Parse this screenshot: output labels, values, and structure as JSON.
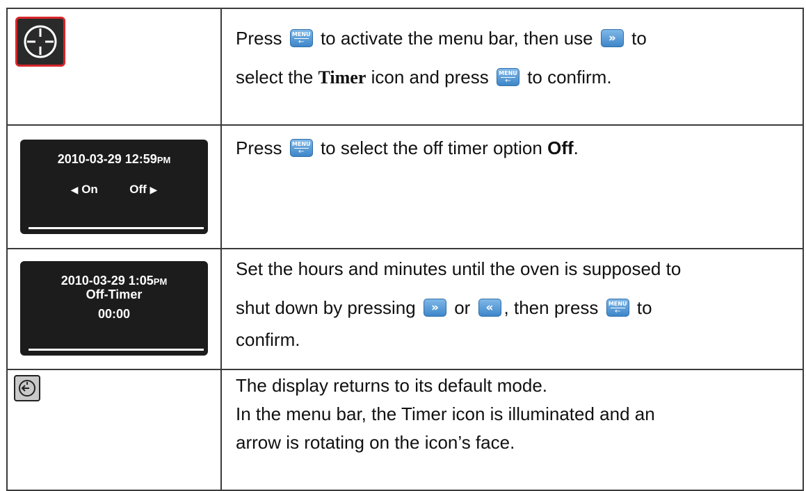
{
  "keys": {
    "menu_label": "MENU",
    "menu_arrow": "←",
    "right_glyph": "»",
    "left_glyph": "«"
  },
  "rows": [
    {
      "segments": [
        "Press",
        "to activate the menu bar, then use",
        "to",
        "select the",
        "Timer",
        "icon and press",
        "to confirm."
      ]
    },
    {
      "screen": {
        "date": "2010-03-29   12:59",
        "pm": "PM",
        "on_label": "On",
        "off_label": "Off",
        "left_arrow": "◀",
        "right_arrow": "▶"
      },
      "segments": [
        "Press",
        "to select the off timer option",
        "Off",
        "."
      ]
    },
    {
      "screen": {
        "date": "2010-03-29   1:05",
        "pm": "PM",
        "title": "Off-Timer",
        "time": "00:00"
      },
      "segments": [
        "Set the hours and minutes until the oven is supposed to",
        "shut down by pressing",
        "or",
        ", then press",
        "to",
        "confirm."
      ]
    },
    {
      "lines": [
        "The display returns to its default mode.",
        "In the menu bar, the Timer icon is illuminated and an",
        "arrow is rotating on the icon’s face."
      ]
    }
  ],
  "colors": {
    "key_blue": "#3e86c9",
    "icon_frame_red": "#d7262b",
    "lcd_background": "#1c1c1c"
  }
}
